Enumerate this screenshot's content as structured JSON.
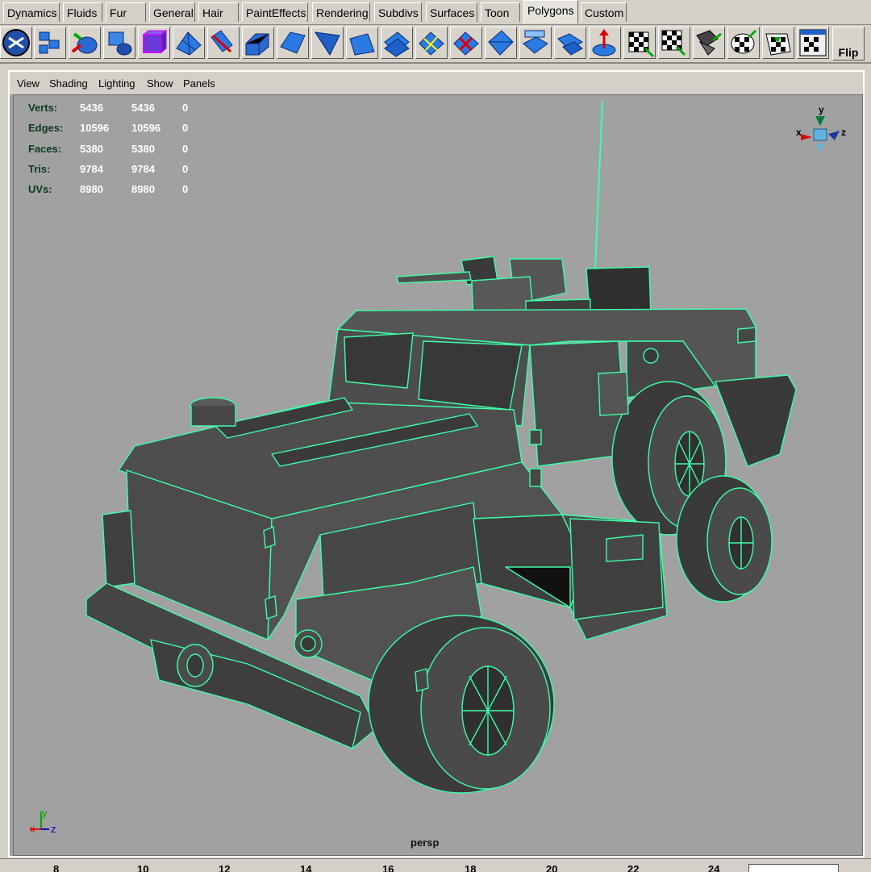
{
  "shelf_tabs": [
    "Dynamics",
    "Fluids",
    "Fur",
    "General",
    "Hair",
    "PaintEffects",
    "Rendering",
    "Subdivs",
    "Surfaces",
    "Toon",
    "Polygons",
    "Custom"
  ],
  "active_tab": "Polygons",
  "shelf_icons": [
    "shelf-menu-icon",
    "create-poly-icon",
    "mirror-poly-icon",
    "poly-sphere-icon",
    "poly-cube-icon",
    "poly-grid-icon",
    "extrude-face-icon",
    "split-poly-icon",
    "bevel-icon",
    "extrude-edge-icon",
    "wedge-face-icon",
    "poke-face-icon",
    "append-poly-icon",
    "subdivide-icon",
    "triangulate-icon",
    "quadrangulate-icon",
    "merge-icon",
    "combine-icon",
    "move-component-icon",
    "planar-map-icon",
    "auto-map-icon",
    "cylindrical-map-icon",
    "spherical-map-icon",
    "uv-texture-editor-icon",
    "uv-snapshot-icon"
  ],
  "flip_label": "Flip",
  "panel_menu": [
    "View",
    "Shading",
    "Lighting",
    "Show",
    "Panels"
  ],
  "hud": {
    "rows": [
      {
        "label": "Verts:",
        "v1": "5436",
        "v2": "5436",
        "v3": "0"
      },
      {
        "label": "Edges:",
        "v1": "10596",
        "v2": "10596",
        "v3": "0"
      },
      {
        "label": "Faces:",
        "v1": "5380",
        "v2": "5380",
        "v3": "0"
      },
      {
        "label": "Tris:",
        "v1": "9784",
        "v2": "9784",
        "v3": "0"
      },
      {
        "label": "UVs:",
        "v1": "8980",
        "v2": "8980",
        "v3": "0"
      }
    ]
  },
  "camera_label": "persp",
  "view_cube": {
    "y": "y",
    "x": "x",
    "z": "z"
  },
  "axis_triad": {
    "x": "x",
    "y": "y",
    "z": "z"
  },
  "timeline_ticks": [
    "8",
    "10",
    "12",
    "14",
    "16",
    "18",
    "20",
    "22",
    "24"
  ],
  "colors": {
    "wire": "#3dffa6",
    "body": "#4b4b4b",
    "viewport_bg": "#a1a1a1",
    "icon_blue": "#1c5fb8"
  }
}
